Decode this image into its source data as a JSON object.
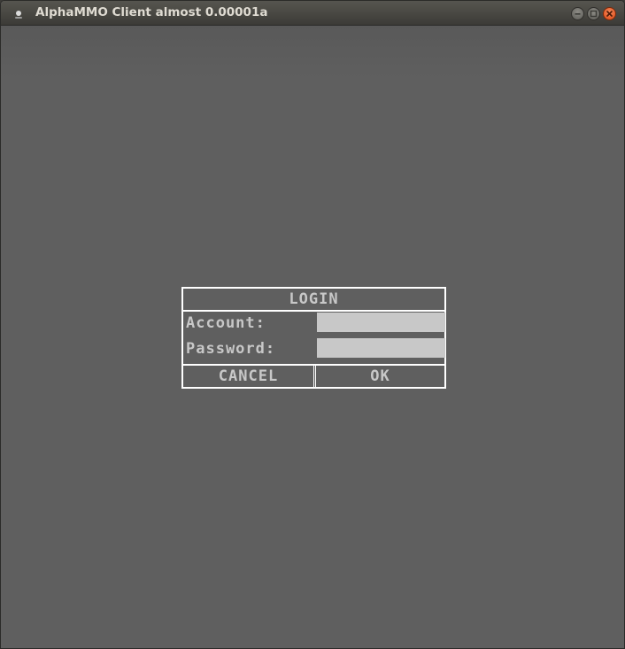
{
  "window": {
    "title": "AlphaMMO Client almost 0.00001a",
    "buttons": {
      "minimize_icon": "minimize-icon",
      "maximize_icon": "maximize-icon",
      "close_icon": "close-icon"
    }
  },
  "login": {
    "title": "LOGIN",
    "account_label": "Account:",
    "account_value": "",
    "password_label": "Password:",
    "password_value": "",
    "cancel_label": "CANCEL",
    "ok_label": "OK"
  },
  "colors": {
    "background": "#5f5f5f",
    "text": "#c8c8c8",
    "border": "#ffffff",
    "input": "#c8c8c8",
    "close_button": "#dd4814"
  }
}
